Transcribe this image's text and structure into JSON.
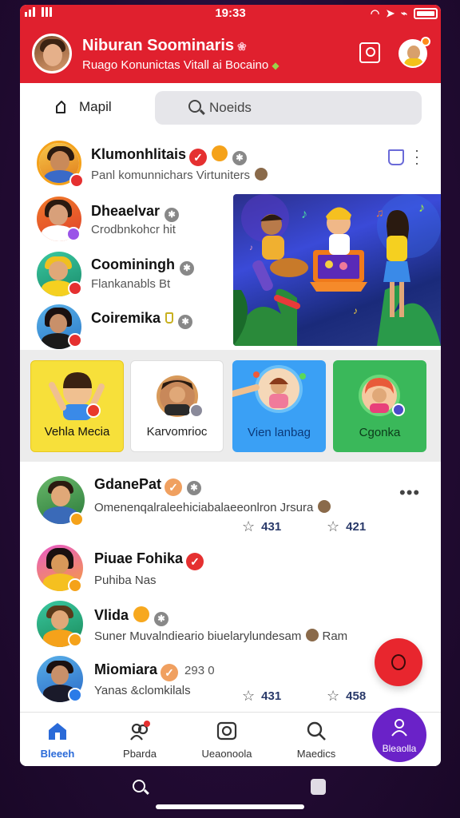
{
  "status": {
    "time": "19:33"
  },
  "header": {
    "title": "Niburan Soominaris",
    "subtitle": "Ruago Konunictas Vitall ai Bocaino"
  },
  "toolbar": {
    "map_label": "Mapil",
    "search_placeholder": "Noeids"
  },
  "stories": [
    {
      "name": "Klumonhlitais",
      "sub": "Panl komunnichars Virtuniters",
      "avatar_bg": "#f5a21a",
      "badge": "red"
    },
    {
      "name": "Dheaelvar",
      "sub": "Crodbnkohcr hit",
      "avatar_bg": "#e85a2a",
      "badge": "purple"
    },
    {
      "name": "Coominingh",
      "sub": "Flankanabls Bt",
      "avatar_bg": "#2aa88a",
      "badge": "red"
    },
    {
      "name": "Coiremika",
      "sub": "",
      "avatar_bg": "#4a9ad8",
      "badge": "red"
    }
  ],
  "tiles": [
    {
      "label": "Vehla Mecia",
      "bg": "#f7e03a"
    },
    {
      "label": "Karvomrioc",
      "bg": "#ffffff"
    },
    {
      "label": "Vien lanbag",
      "bg": "#3aa0f5"
    },
    {
      "label": "Cgonka",
      "bg": "#3ab85a"
    }
  ],
  "feed": [
    {
      "name": "GdanePat",
      "sub": "Omenenqalraleehiciabalaeeonlron Jrsura",
      "likes": "431",
      "shares": "421",
      "badge": "orange"
    },
    {
      "name": "Piuae Fohika",
      "sub": "Puhiba Nas",
      "badge": "orange"
    },
    {
      "name": "Vlida",
      "sub": "Suner Muvalndieario biuelarylundesam",
      "extra": "Ram",
      "badge": "orange"
    },
    {
      "name": "Miomiara",
      "date": "293 0",
      "sub": "Yanas &clomkilals",
      "likes": "431",
      "shares": "458",
      "badge": "blue"
    }
  ],
  "tabs": [
    {
      "label": "Bleeeh",
      "icon": "home-icon",
      "active": true
    },
    {
      "label": "Pbarda",
      "icon": "people-icon",
      "badge_count": "1"
    },
    {
      "label": "Ueaonoola",
      "icon": "camera-icon"
    },
    {
      "label": "Maedics",
      "icon": "search-icon"
    },
    {
      "label": "Bleaolla",
      "icon": "profile-icon"
    }
  ],
  "colors": {
    "brand_red": "#e0202e",
    "accent_blue": "#2a6ad8",
    "profile_purple": "#6a22c8",
    "background": "#2a0f3d"
  }
}
